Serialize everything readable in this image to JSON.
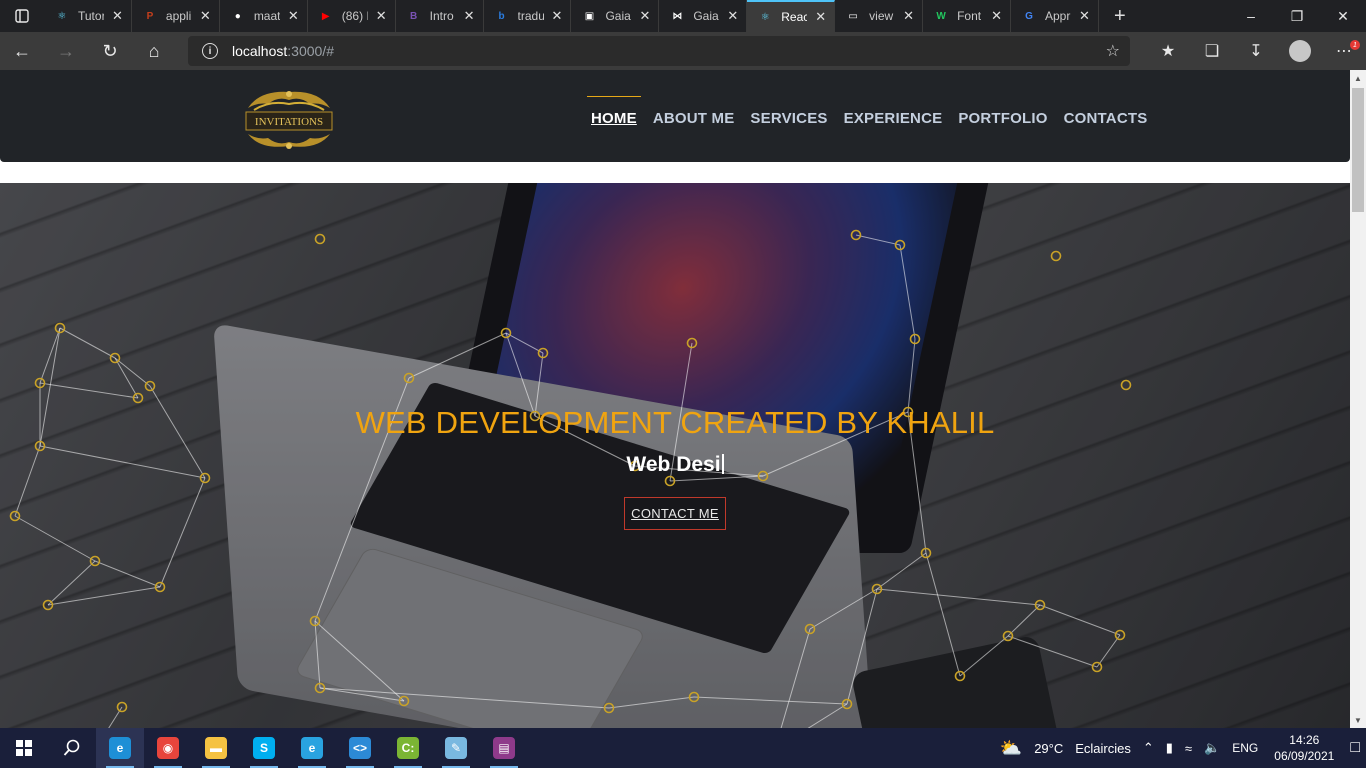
{
  "browser": {
    "tabs": [
      {
        "title": "Tutor",
        "fav": "react-icon",
        "color": "#61dafb",
        "active": false
      },
      {
        "title": "appli",
        "fav": "powerpoint-icon",
        "color": "#c43e1c",
        "active": false
      },
      {
        "title": "maat",
        "fav": "github-icon",
        "color": "#ffffff",
        "active": false
      },
      {
        "title": "(86) I",
        "fav": "youtube-icon",
        "color": "#ff0000",
        "active": false
      },
      {
        "title": "Intro",
        "fav": "bootstrap-icon",
        "color": "#7952b3",
        "active": false
      },
      {
        "title": "tradu",
        "fav": "bing-icon",
        "color": "#2a7de1",
        "active": false
      },
      {
        "title": "Gaia",
        "fav": "gaia-icon",
        "color": "#ffffff",
        "active": false
      },
      {
        "title": "Gaia",
        "fav": "gaia-bow-icon",
        "color": "#ffffff",
        "active": false
      },
      {
        "title": "Reac",
        "fav": "react-icon",
        "color": "#61dafb",
        "active": true
      },
      {
        "title": "view",
        "fav": "page-icon",
        "color": "#ffffff",
        "active": false
      },
      {
        "title": "Font",
        "fav": "webflow-icon",
        "color": "#22c55e",
        "active": false
      },
      {
        "title": "Appr",
        "fav": "google-icon",
        "color": "#4285f4",
        "active": false
      }
    ],
    "url_host": "localhost",
    "url_path": ":3000/#"
  },
  "site": {
    "logo_text": "INVITATIONS",
    "nav": [
      {
        "label": "HOME",
        "active": true
      },
      {
        "label": "ABOUT ME",
        "active": false
      },
      {
        "label": "SERVICES",
        "active": false
      },
      {
        "label": "EXPERIENCE",
        "active": false
      },
      {
        "label": "PORTFOLIO",
        "active": false
      },
      {
        "label": "CONTACTS",
        "active": false
      }
    ],
    "hero": {
      "title": "WEB DEVELOPMENT CREATED BY KHALIL",
      "subtitle": "Web Desi",
      "cta": "CONTACT ME"
    },
    "colors": {
      "accent": "#f0a410",
      "header_bg": "#212428",
      "cta_border": "#c0392b"
    }
  },
  "taskbar": {
    "apps": [
      {
        "name": "edge-icon",
        "active": true
      },
      {
        "name": "chrome-icon",
        "active": false
      },
      {
        "name": "file-explorer-icon",
        "active": false
      },
      {
        "name": "skype-icon",
        "active": false
      },
      {
        "name": "edge-beta-icon",
        "active": false
      },
      {
        "name": "vscode-icon",
        "active": false
      },
      {
        "name": "terminal-icon",
        "active": false
      },
      {
        "name": "notepad-icon",
        "active": false
      },
      {
        "name": "winrar-icon",
        "active": false
      }
    ],
    "weather_temp": "29°C",
    "weather_text": "Eclaircies",
    "lang": "ENG",
    "time": "14:26",
    "date": "06/09/2021"
  }
}
